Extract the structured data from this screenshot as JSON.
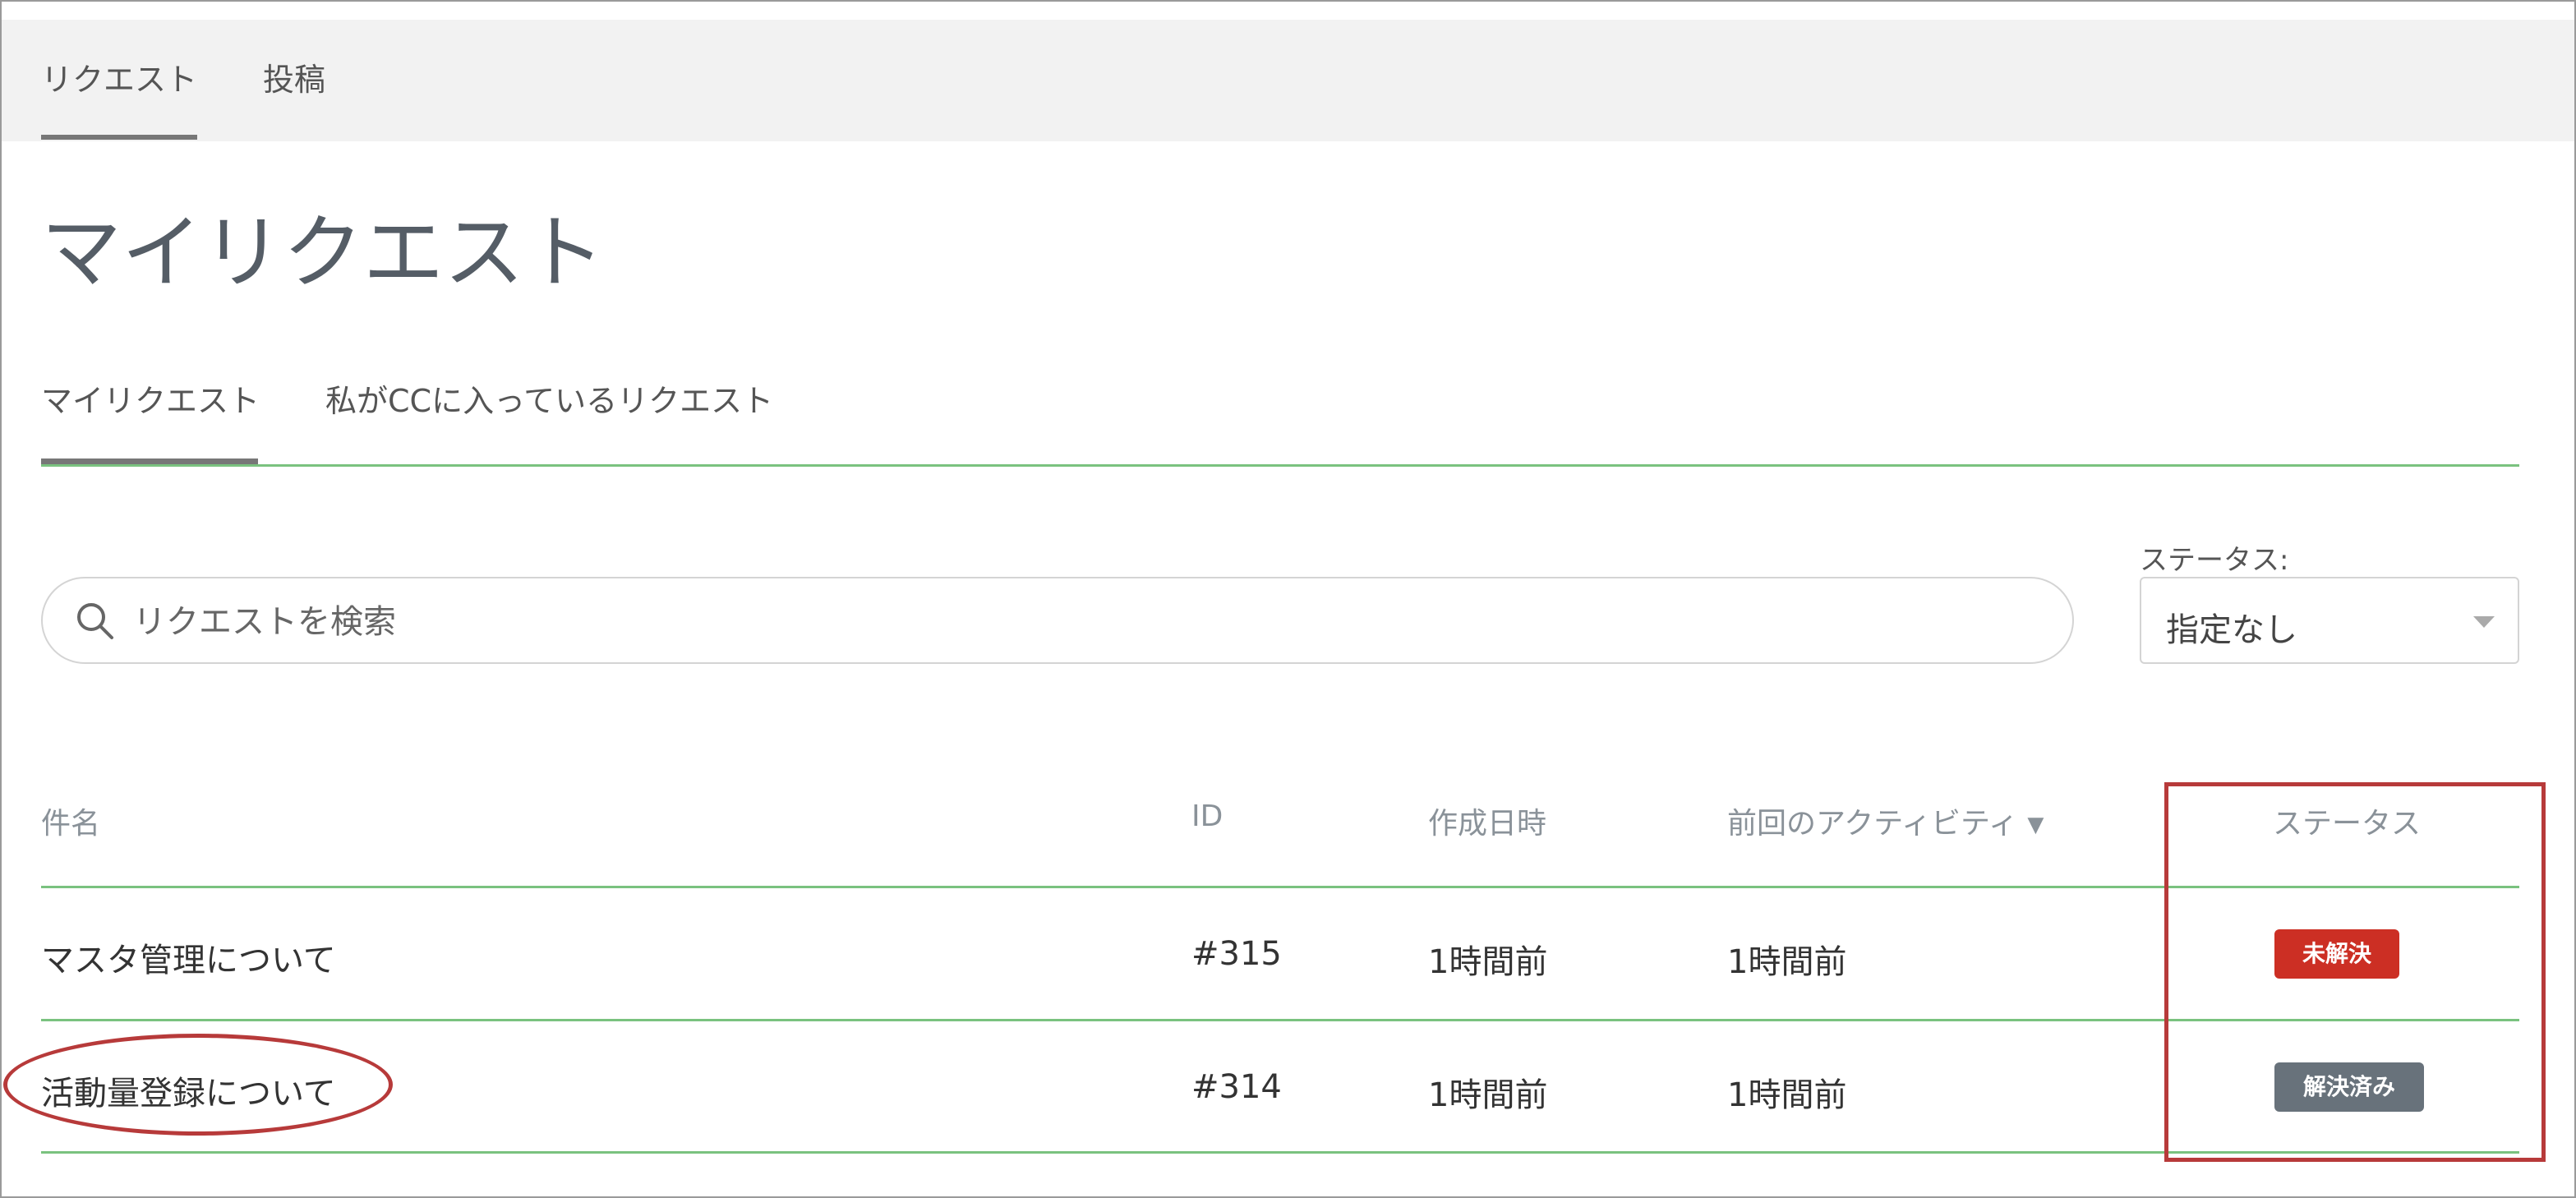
{
  "nav": {
    "tabs": [
      {
        "label": "リクエスト",
        "active": true
      },
      {
        "label": "投稿",
        "active": false
      }
    ]
  },
  "page": {
    "title": "マイリクエスト"
  },
  "subtabs": [
    {
      "label": "マイリクエスト",
      "active": true
    },
    {
      "label": "私がCCに入っているリクエスト",
      "active": false
    }
  ],
  "search": {
    "placeholder": "リクエストを検索",
    "icon": "search-icon"
  },
  "status_filter": {
    "label": "ステータス:",
    "selected": "指定なし"
  },
  "table": {
    "headers": {
      "subject": "件名",
      "id": "ID",
      "created": "作成日時",
      "last_activity": "前回のアクティビティ",
      "last_activity_sort": "▼",
      "status": "ステータス"
    },
    "rows": [
      {
        "subject": "マスタ管理について",
        "id": "#315",
        "created": "1時間前",
        "last_activity": "1時間前",
        "status": "未解決"
      },
      {
        "subject": "活動量登録について",
        "id": "#314",
        "created": "1時間前",
        "last_activity": "1時間前",
        "status": "解決済み"
      }
    ]
  },
  "colors": {
    "accent_line": "#7ac27f",
    "status_open": "#cc2f24",
    "status_solved": "#68727b",
    "annotation": "#b73a3a"
  }
}
